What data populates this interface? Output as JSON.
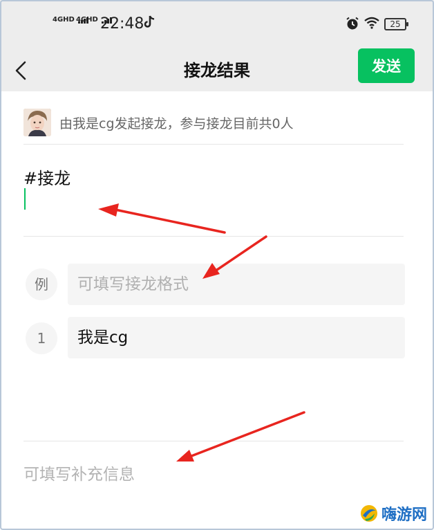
{
  "status_bar": {
    "signal_1": "4GHD",
    "signal_2": "4GHD",
    "time": "22:48",
    "battery": "25",
    "icons": [
      "tiktok-icon",
      "alarm-icon",
      "wifi-icon",
      "battery-icon"
    ]
  },
  "nav": {
    "title": "接龙结果",
    "send_label": "发送",
    "back_icon": "chevron-left-icon"
  },
  "initiator": {
    "text": "由我是cg发起接龙，参与接龙目前共0人"
  },
  "topic": {
    "text": "#接龙"
  },
  "rows": [
    {
      "index": "例",
      "placeholder": "可填写接龙格式",
      "value": ""
    },
    {
      "index": "1",
      "placeholder": "",
      "value": "我是cg"
    }
  ],
  "supplement": {
    "placeholder": "可填写补充信息"
  },
  "watermark": {
    "text": "嗨游网"
  },
  "colors": {
    "accent": "#07c160",
    "nav_bg": "#ededed",
    "field_bg": "#f5f5f5",
    "annotation_arrow": "#e8251f"
  }
}
